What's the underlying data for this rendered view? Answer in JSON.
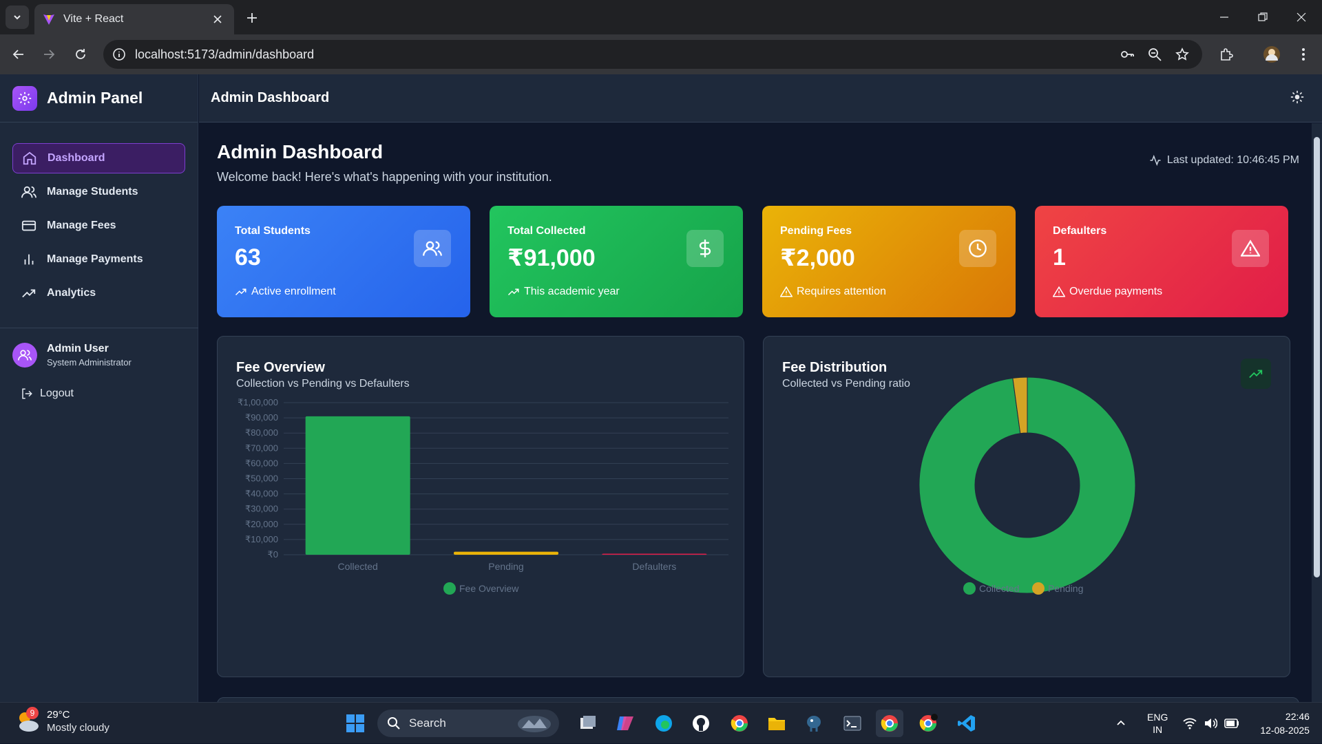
{
  "browser": {
    "tab_title": "Vite + React",
    "url": "localhost:5173/admin/dashboard"
  },
  "app": {
    "brand": "Admin Panel",
    "header_title": "Admin Dashboard",
    "nav": [
      {
        "label": "Dashboard",
        "icon": "home-icon",
        "active": true
      },
      {
        "label": "Manage Students",
        "icon": "users-icon",
        "active": false
      },
      {
        "label": "Manage Fees",
        "icon": "credit-card-icon",
        "active": false
      },
      {
        "label": "Manage Payments",
        "icon": "bar-chart-icon",
        "active": false
      },
      {
        "label": "Analytics",
        "icon": "trending-up-icon",
        "active": false
      }
    ],
    "user": {
      "name": "Admin User",
      "role": "System Administrator"
    },
    "logout": "Logout"
  },
  "page": {
    "title": "Admin Dashboard",
    "subtitle": "Welcome back! Here's what's happening with your institution.",
    "last_updated": "Last updated: 10:46:45 PM"
  },
  "cards": [
    {
      "label": "Total Students",
      "value": "63",
      "foot": "Active enrollment",
      "color": "#2563eb",
      "icon": "users-icon",
      "foot_icon": "trending-up-icon"
    },
    {
      "label": "Total Collected",
      "value": "₹91,000",
      "foot": "This academic year",
      "color": "#16a34a",
      "icon": "dollar-icon",
      "foot_icon": "trending-up-icon"
    },
    {
      "label": "Pending Fees",
      "value": "₹2,000",
      "foot": "Requires attention",
      "color": "#d97706",
      "icon": "clock-icon",
      "foot_icon": "alert-triangle-icon"
    },
    {
      "label": "Defaulters",
      "value": "1",
      "foot": "Overdue payments",
      "color": "#e11d48",
      "icon": "alert-triangle-icon",
      "foot_icon": "alert-triangle-icon"
    }
  ],
  "fee_overview": {
    "title": "Fee Overview",
    "subtitle": "Collection vs Pending vs Defaulters"
  },
  "fee_distribution": {
    "title": "Fee Distribution",
    "subtitle": "Collected vs Pending ratio"
  },
  "chart_data": [
    {
      "type": "bar",
      "title": "Fee Overview",
      "categories": [
        "Collected",
        "Pending",
        "Defaulters"
      ],
      "values": [
        91000,
        2000,
        1
      ],
      "bar_colors": [
        "#22a755",
        "#eab308",
        "#e11d48"
      ],
      "yticks": [
        "₹0",
        "₹10,000",
        "₹20,000",
        "₹30,000",
        "₹40,000",
        "₹50,000",
        "₹60,000",
        "₹70,000",
        "₹80,000",
        "₹90,000",
        "₹1,00,000"
      ],
      "ylim": [
        0,
        100000
      ],
      "legend": [
        {
          "name": "Fee Overview",
          "color": "#22a755"
        }
      ],
      "grid": true
    },
    {
      "type": "pie",
      "title": "Fee Distribution",
      "labels": [
        "Collected",
        "Pending"
      ],
      "values": [
        91000,
        2000
      ],
      "colors": [
        "#22a755",
        "#d4a425"
      ],
      "donut": true,
      "legend": [
        {
          "name": "Collected",
          "color": "#22a755"
        },
        {
          "name": "Pending",
          "color": "#d4a425"
        }
      ]
    }
  ],
  "taskbar": {
    "temperature": "29°C",
    "weather": "Mostly cloudy",
    "weather_badge": "9",
    "search": "Search",
    "lang_top": "ENG",
    "lang_bottom": "IN",
    "time": "22:46",
    "date": "12-08-2025"
  }
}
